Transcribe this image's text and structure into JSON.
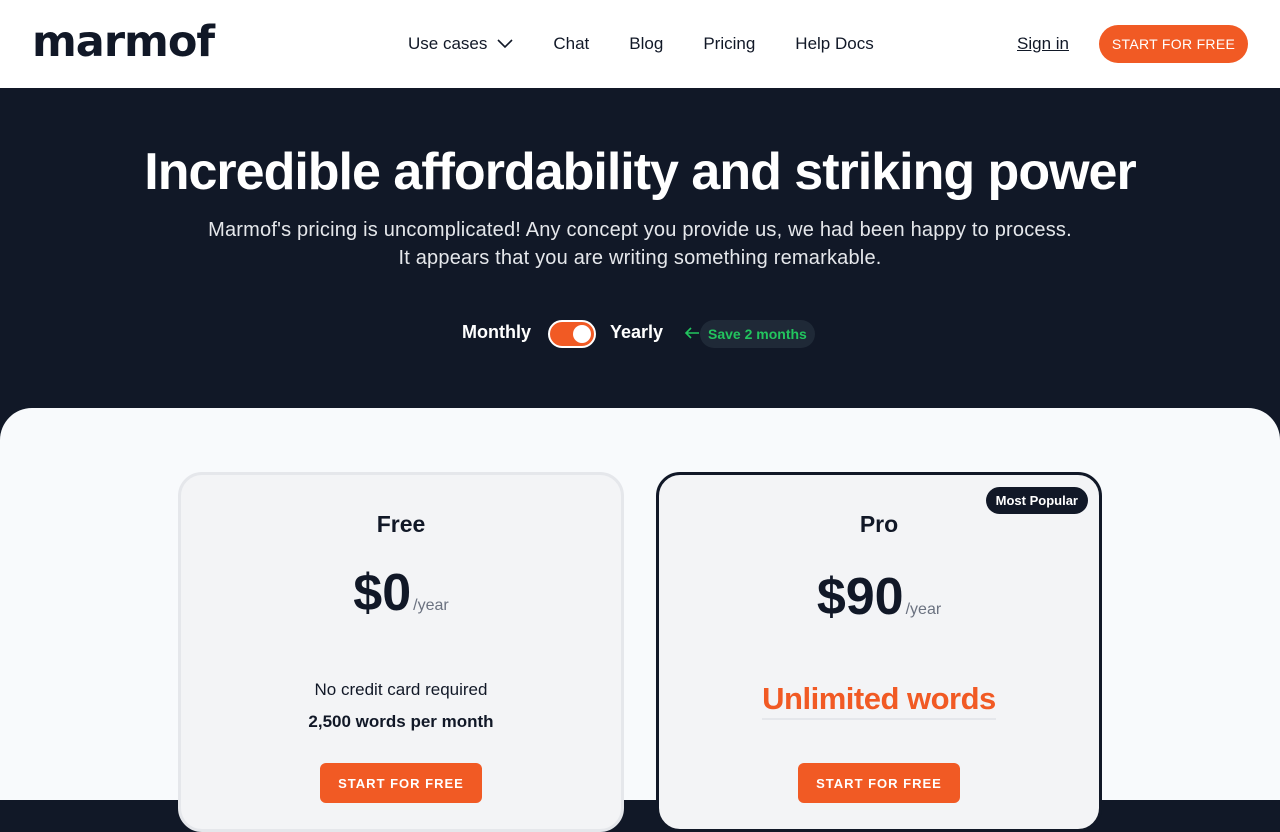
{
  "brand": {
    "name": "marmof"
  },
  "nav": {
    "items": [
      {
        "label": "Use cases",
        "has_dropdown": true
      },
      {
        "label": "Chat"
      },
      {
        "label": "Blog"
      },
      {
        "label": "Pricing"
      },
      {
        "label": "Help Docs"
      }
    ],
    "sign_in": "Sign in",
    "cta": "START FOR FREE"
  },
  "hero": {
    "title": "Incredible affordability and striking power",
    "subtitle_line1": "Marmof's pricing is uncomplicated! Any concept you provide us, we had been happy to process.",
    "subtitle_line2": "It appears that you are writing something remarkable."
  },
  "billing_toggle": {
    "monthly_label": "Monthly",
    "yearly_label": "Yearly",
    "selected": "Yearly",
    "save_badge": "Save 2 months"
  },
  "plans": [
    {
      "name": "Free",
      "price": "$0",
      "period": "/year",
      "note": "No credit card required",
      "feature": "2,500 words per month",
      "button": "START FOR FREE"
    },
    {
      "name": "Pro",
      "price": "$90",
      "period": "/year",
      "badge": "Most Popular",
      "feature": "Unlimited words",
      "button": "START FOR FREE"
    }
  ],
  "colors": {
    "accent": "#f15a24",
    "dark": "#111827",
    "save_green": "#22c55e",
    "light_bg": "#f8fafc"
  }
}
